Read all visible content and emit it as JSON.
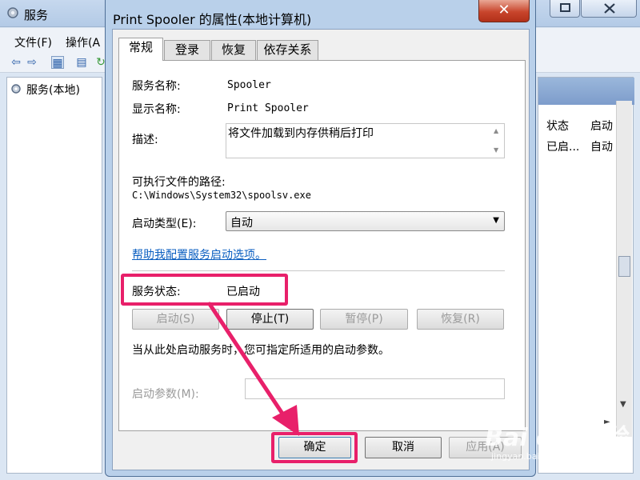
{
  "background_window": {
    "title": "服务",
    "menu": {
      "file": "文件(F)",
      "action": "操作(A"
    },
    "tree_item": "服务(本地)",
    "columns": {
      "status": "状态",
      "startup": "启动"
    },
    "row": {
      "status": "已启...",
      "startup": "自动"
    }
  },
  "dialog": {
    "title": "Print Spooler 的属性(本地计算机)",
    "close_label": "✕",
    "tabs": [
      {
        "label": "常规",
        "active": true
      },
      {
        "label": "登录",
        "active": false
      },
      {
        "label": "恢复",
        "active": false
      },
      {
        "label": "依存关系",
        "active": false
      }
    ],
    "service_name_label": "服务名称:",
    "service_name": "Spooler",
    "display_name_label": "显示名称:",
    "display_name": "Print Spooler",
    "description_label": "描述:",
    "description": "将文件加载到内存供稍后打印",
    "path_label": "可执行文件的路径:",
    "path": "C:\\Windows\\System32\\spoolsv.exe",
    "startup_type_label": "启动类型(E):",
    "startup_type": "自动",
    "help_link": "帮助我配置服务启动选项。",
    "status_label": "服务状态:",
    "status_value": "已启动",
    "buttons": {
      "start": "启动(S)",
      "stop": "停止(T)",
      "pause": "暂停(P)",
      "resume": "恢复(R)"
    },
    "hint": "当从此处启动服务时，您可指定所适用的启动参数。",
    "params_label": "启动参数(M):",
    "params_value": "",
    "ok": "确定",
    "cancel": "取消",
    "apply": "应用(A)"
  },
  "annotation": {
    "color": "#e8206a"
  },
  "watermark": {
    "brand": "Bai du 经验",
    "url": "jingyan.baidu.com"
  }
}
